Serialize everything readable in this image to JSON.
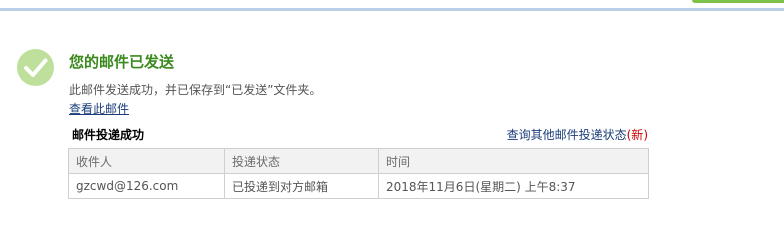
{
  "colors": {
    "title_green": "#3b8a1e",
    "link_blue": "#1a3d7a",
    "new_red": "#cc0000",
    "top_accent_green": "#7ec24a",
    "top_border_blue": "#b9cfe8"
  },
  "header": {
    "success_icon": "checkmark-circle-icon",
    "title": "您的邮件已发送",
    "description": "此邮件发送成功，并已保存到“已发送”文件夹。",
    "view_link": "查看此邮件"
  },
  "delivery": {
    "section_title": "邮件投递成功",
    "query_link": "查询其他邮件投递状态",
    "query_paren_open": "(",
    "query_new": "新",
    "query_paren_close": ")",
    "table": {
      "headers": [
        "收件人",
        "投递状态",
        "时间"
      ],
      "rows": [
        [
          "gzcwd@126.com",
          "已投递到对方邮箱",
          "2018年11月6日(星期二) 上午8:37"
        ]
      ]
    }
  }
}
